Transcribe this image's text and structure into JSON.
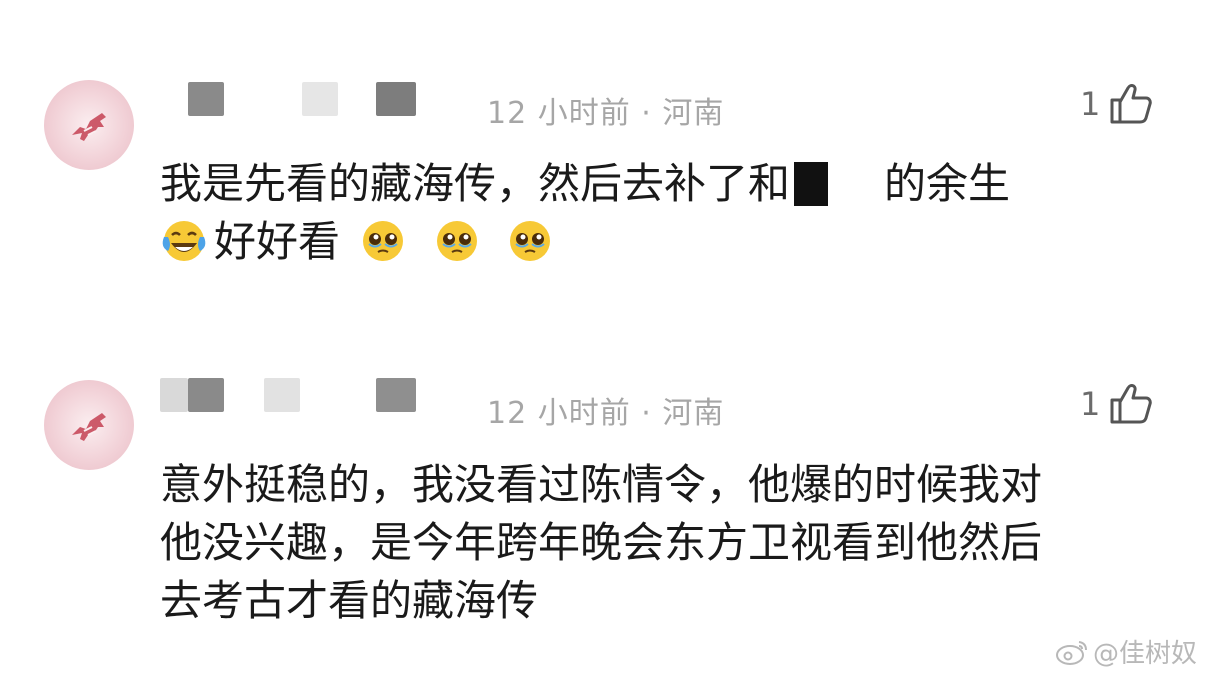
{
  "comments": [
    {
      "meta": "12 小时前 · 河南",
      "like_count": "1",
      "lines": [
        [
          "我是先看的藏海传，然后去补了和",
          "的余生"
        ],
        [
          "好好看"
        ]
      ]
    },
    {
      "meta": "12 小时前 · 河南",
      "like_count": "1",
      "lines": [
        "意外挺稳的，我没看过陈情令，他爆的时候我对",
        "他没兴趣，是今年跨年晚会东方卫视看到他然后",
        "去考古才看的藏海传"
      ]
    }
  ],
  "watermark": {
    "text": "@佳树奴",
    "icon": "weibo-icon"
  },
  "icons": {
    "like": "thumbs-up-icon",
    "emoji_laugh": "tears-of-joy-emoji",
    "emoji_plead": "pleading-face-emoji"
  }
}
